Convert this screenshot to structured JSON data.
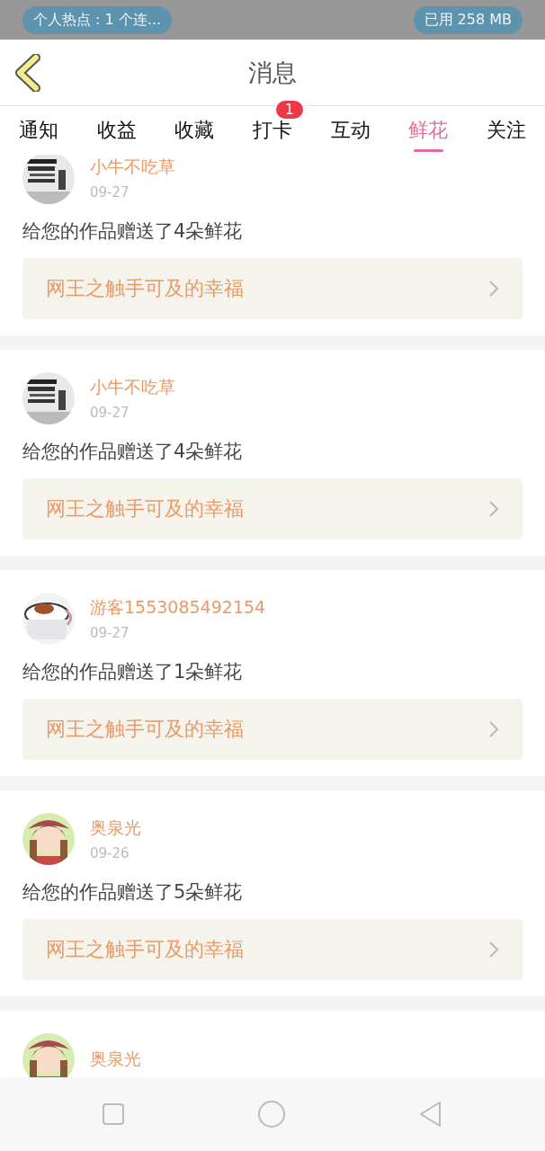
{
  "status_bar": {
    "hotspot": "个人热点 : 1 个连...",
    "data_used": "已用 258 MB"
  },
  "header": {
    "title": "消息"
  },
  "tabs": [
    {
      "label": "通知",
      "selected": false
    },
    {
      "label": "收益",
      "selected": false
    },
    {
      "label": "收藏",
      "selected": false
    },
    {
      "label": "打卡",
      "selected": false,
      "badge": "1"
    },
    {
      "label": "互动",
      "selected": false
    },
    {
      "label": "鲜花",
      "selected": true
    },
    {
      "label": "关注",
      "selected": false
    }
  ],
  "messages": [
    {
      "name": "小牛不吃草",
      "date": "09-27",
      "text": "给您的作品赠送了4朵鲜花",
      "work": "网王之触手可及的幸福"
    },
    {
      "name": "小牛不吃草",
      "date": "09-27",
      "text": "给您的作品赠送了4朵鲜花",
      "work": "网王之触手可及的幸福"
    },
    {
      "name": "游客1553085492154",
      "date": "09-27",
      "text": "给您的作品赠送了1朵鲜花",
      "work": "网王之触手可及的幸福"
    },
    {
      "name": "奥泉光",
      "date": "09-26",
      "text": "给您的作品赠送了5朵鲜花",
      "work": "网王之触手可及的幸福"
    },
    {
      "name": "奥泉光"
    }
  ]
}
